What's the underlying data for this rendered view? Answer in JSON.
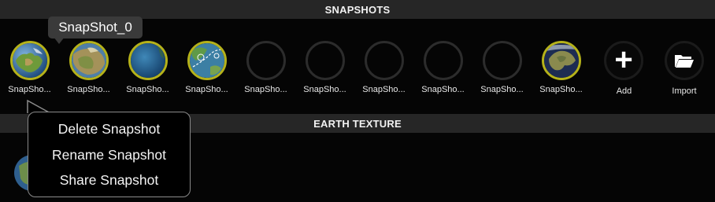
{
  "headers": {
    "snapshots": "SNAPSHOTS",
    "earth_texture": "EARTH TEXTURE"
  },
  "tooltip": {
    "text": "SnapShot_0"
  },
  "snapshots": [
    {
      "label": "SnapSho...",
      "state": "filled",
      "thumb": "earth-globe-icon"
    },
    {
      "label": "SnapSho...",
      "state": "filled",
      "thumb": "earth-desert-icon"
    },
    {
      "label": "SnapSho...",
      "state": "filled",
      "thumb": "ocean-globe-icon"
    },
    {
      "label": "SnapSho...",
      "state": "filled",
      "thumb": "weather-globe-icon"
    },
    {
      "label": "SnapSho...",
      "state": "empty"
    },
    {
      "label": "SnapSho...",
      "state": "empty"
    },
    {
      "label": "SnapSho...",
      "state": "empty"
    },
    {
      "label": "SnapSho...",
      "state": "empty"
    },
    {
      "label": "SnapSho...",
      "state": "empty"
    },
    {
      "label": "SnapSho...",
      "state": "filled",
      "thumb": "europe-night-globe-icon"
    }
  ],
  "actions": {
    "add_label": "Add",
    "import_label": "Import"
  },
  "context_menu": {
    "items": [
      "Delete Snapshot",
      "Rename Snapshot",
      "Share Snapshot"
    ]
  },
  "colors": {
    "accent_ring": "#b5b21a",
    "header_bg": "#262626",
    "background": "#050505"
  }
}
